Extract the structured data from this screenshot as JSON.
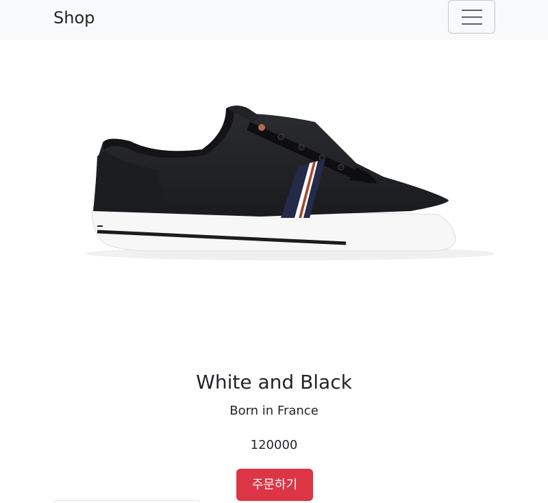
{
  "navbar": {
    "brand": "Shop",
    "toggler_icon": "hamburger-menu-icon"
  },
  "product": {
    "image_icon": "sneaker-image",
    "title": "White and Black",
    "origin": "Born in France",
    "price": "120000",
    "order_label": "주문하기"
  },
  "colors": {
    "navbar_bg": "#f8f9fa",
    "button_danger": "#dc3545",
    "text": "#212529"
  }
}
